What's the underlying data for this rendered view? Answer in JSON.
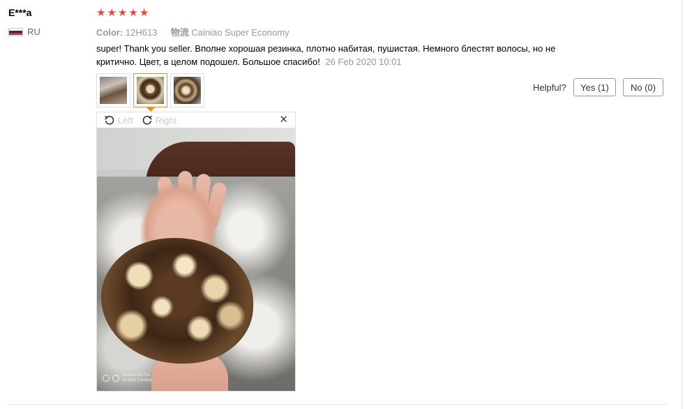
{
  "review": {
    "username": "E***a",
    "country_code": "RU",
    "rating": 5,
    "stars": [
      "★",
      "★",
      "★",
      "★",
      "★"
    ],
    "color_label": "Color:",
    "color_value": "12H613",
    "shipping_label": "物流",
    "shipping_value": "Cainiao Super Economy",
    "text": "super! Thank you seller. Вполне хорошая резинка, плотно набитая, пушистая. Немного блестят волосы, но не критично. Цвет, в целом подошел. Большое спасибо!",
    "date": "26 Feb 2020 10:01",
    "thumbnails": [
      {
        "icon": "review-photo-1",
        "selected": false
      },
      {
        "icon": "review-photo-2",
        "selected": true
      },
      {
        "icon": "review-photo-3",
        "selected": false
      }
    ]
  },
  "helpful": {
    "label": "Helpful?",
    "yes_label": "Yes (1)",
    "no_label": "No (0)"
  },
  "viewer": {
    "rotate_left_label": "Left",
    "rotate_right_label": "Right",
    "close_symbol": "✕",
    "watermark_line1": "Lenovo K8 Pro",
    "watermark_line2": "AI Dual Camera"
  },
  "colors": {
    "star": "#f44336",
    "selected_thumb_border": "#ff8c00",
    "flag": [
      "#ffffff",
      "#0039a6",
      "#d52b1e"
    ]
  }
}
